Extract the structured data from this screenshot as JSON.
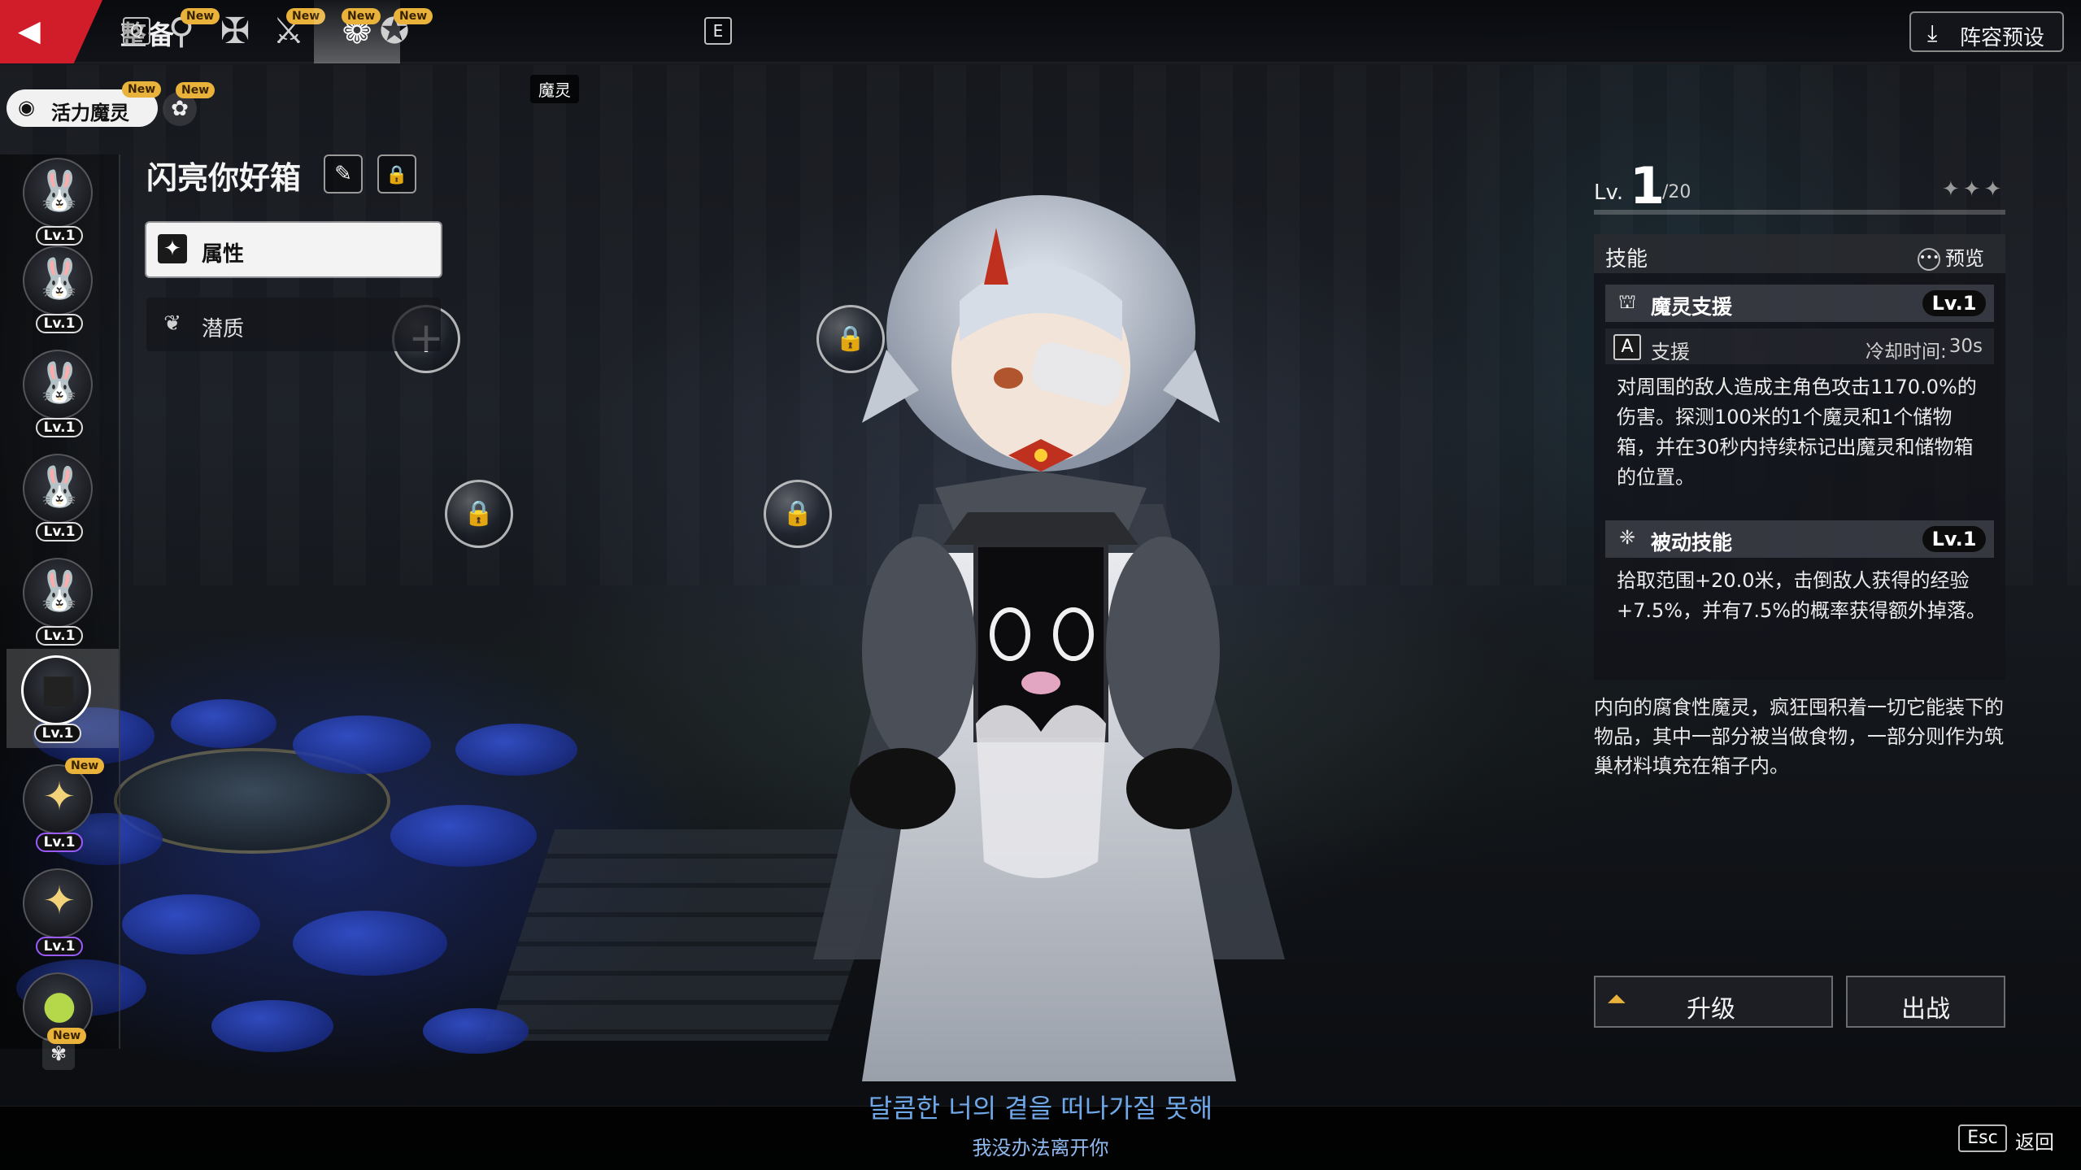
{
  "topbar": {
    "title": "整备",
    "key_prev": "Q",
    "key_next": "E",
    "active_tab_tooltip": "魔灵",
    "new_badge": "New",
    "preset_label": "阵容预设"
  },
  "filters": {
    "active_label": "活力魔灵"
  },
  "roster": [
    {
      "level": "Lv.1"
    },
    {
      "level": "Lv.1"
    },
    {
      "level": "Lv.1"
    },
    {
      "level": "Lv.1"
    },
    {
      "level": "Lv.1"
    },
    {
      "level": "Lv.1"
    },
    {
      "level": "Lv.1"
    },
    {
      "level": "Lv.1"
    }
  ],
  "pet": {
    "name": "闪亮你好箱",
    "tabs": [
      "属性",
      "潜质"
    ],
    "level": "1",
    "level_prefix": "Lv.",
    "level_max": "/20",
    "stars": 3,
    "lore": "内向的腐食性魔灵，疯狂囤积着一切它能装下的物品，其中一部分被当做食物，一部分则作为筑巢材料填充在箱子内。"
  },
  "skills": {
    "header": "技能",
    "preview_label": "预览",
    "active": {
      "name": "魔灵支援",
      "level": "Lv.1",
      "key": "A",
      "type": "支援",
      "cooldown_label": "冷却时间:",
      "cooldown": "30s",
      "description": "对周围的敌人造成主角色攻击1170.0%的伤害。探测100米的1个魔灵和1个储物箱，并在30秒内持续标记出魔灵和储物箱的位置。"
    },
    "passive": {
      "name": "被动技能",
      "level": "Lv.1",
      "description": "拾取范围+20.0米，击倒敌人获得的经验+7.5%，并有7.5%的概率获得额外掉落。"
    }
  },
  "actions": {
    "upgrade": "升级",
    "deploy": "出战"
  },
  "subtitles": {
    "korean": "달콤한 너의 곁을 떠나가질 못해",
    "chinese": "我没办法离开你"
  },
  "footer": {
    "esc_key": "Esc",
    "back_label": "返回"
  },
  "colors": {
    "accent_gold": "#e9b23a",
    "brand_red": "#d11c2a",
    "subtitle_blue": "#6fa8e8"
  }
}
